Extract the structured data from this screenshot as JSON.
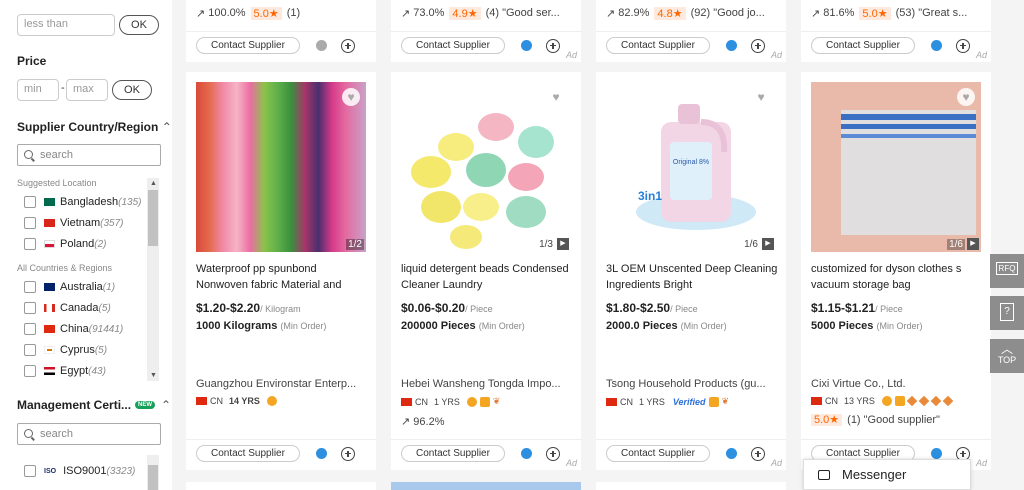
{
  "sidebar": {
    "less_than_placeholder": "less than",
    "ok_label": "OK",
    "price_title": "Price",
    "min_placeholder": "min",
    "max_placeholder": "max",
    "price_sep": "-",
    "country_title": "Supplier Country/Region",
    "search_placeholder": "search",
    "suggested_label": "Suggested Location",
    "all_label": "All Countries & Regions",
    "suggested": [
      {
        "name": "Bangladesh",
        "count": "(135)",
        "flag": "#006a4e"
      },
      {
        "name": "Vietnam",
        "count": "(357)",
        "flag": "#da251d"
      },
      {
        "name": "Poland",
        "count": "(2)",
        "flag": "#dc143c"
      }
    ],
    "countries": [
      {
        "name": "Australia",
        "count": "(1)",
        "flag": "#012169"
      },
      {
        "name": "Canada",
        "count": "(5)",
        "flag": "#d52b1e"
      },
      {
        "name": "China",
        "count": "(91441)",
        "flag": "#de2910"
      },
      {
        "name": "Cyprus",
        "count": "(5)",
        "flag": "#d57800"
      },
      {
        "name": "Egypt",
        "count": "(43)",
        "flag": "#ce1126"
      }
    ],
    "mgmt_title": "Management Certi...",
    "mgmt_badge": "NEW",
    "mgmt_search_placeholder": "search",
    "certs": [
      {
        "name": "ISO9001",
        "count": "(3323)"
      }
    ]
  },
  "top_cards": [
    {
      "pct": "100.0%",
      "rating": "5.0★",
      "reviews": "(1)"
    },
    {
      "pct": "73.0%",
      "rating": "4.9★",
      "reviews": "(4) \"Good ser..."
    },
    {
      "pct": "82.9%",
      "rating": "4.8★",
      "reviews": "(92) \"Good jo..."
    },
    {
      "pct": "81.6%",
      "rating": "5.0★",
      "reviews": "(53) \"Great s..."
    }
  ],
  "common": {
    "contact_label": "Contact Supplier",
    "ad_label": "Ad",
    "country_code": "CN",
    "min_order": "(Min Order)",
    "verified": "Verified"
  },
  "products": [
    {
      "title": "Waterproof pp spunbond Nonwoven fabric Material and",
      "price": "$1.20-$2.20",
      "unit": "/ Kilogram",
      "moq": "1000 Kilograms",
      "company": "Guangzhou Environstar Enterp...",
      "years": "14 YRS",
      "img_count": "1/2"
    },
    {
      "title": "liquid detergent beads Condensed Cleaner Laundry",
      "price": "$0.06-$0.20",
      "unit": "/ Piece",
      "moq": "200000 Pieces",
      "company": "Hebei Wansheng Tongda Impo...",
      "years": "1 YRS",
      "img_count": "1/3",
      "extra_pct": "96.2%"
    },
    {
      "title": "3L OEM Unscented Deep Cleaning Ingredients Bright",
      "price": "$1.80-$2.50",
      "unit": "/ Piece",
      "moq": "2000.0 Pieces",
      "company": "Tsong Household Products (gu...",
      "years": "1 YRS",
      "img_count": "1/6",
      "bottle_text": "Original 8%"
    },
    {
      "title": "customized for dyson clothes s vacuum storage bag",
      "price": "$1.15-$1.21",
      "unit": "/ Piece",
      "moq": "5000 Pieces",
      "company": "Cixi Virtue Co., Ltd.",
      "years": "13 YRS",
      "img_count": "1/6",
      "rating": "5.0★",
      "review": "(1) \"Good supplier\""
    }
  ],
  "right_rail": {
    "rfq": "RFQ",
    "top": "TOP"
  },
  "messenger_label": "Messenger"
}
